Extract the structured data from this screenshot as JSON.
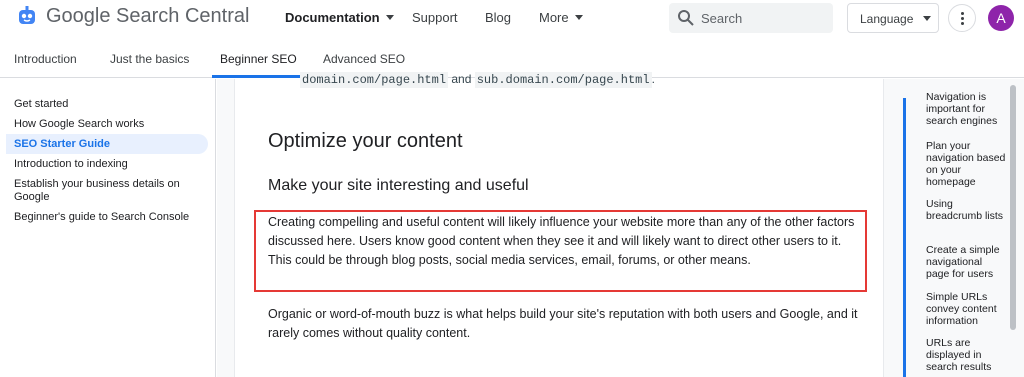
{
  "header": {
    "brand": "Google Search Central",
    "nav": [
      "Documentation",
      "Support",
      "Blog",
      "More"
    ],
    "search_placeholder": "Search",
    "language_label": "Language",
    "avatar_initial": "A"
  },
  "subnav": {
    "tabs": [
      "Introduction",
      "Just the basics",
      "Beginner SEO",
      "Advanced SEO"
    ],
    "active_tab": "Beginner SEO"
  },
  "sidebar": {
    "items": [
      "Get started",
      "How Google Search works",
      "SEO Starter Guide",
      "Introduction to indexing",
      "Establish your business details on Google",
      "Beginner's guide to Search Console"
    ],
    "active_item": "SEO Starter Guide"
  },
  "content": {
    "code_prefix": "domain.com/page.html",
    "code_and": " and ",
    "code_suffix": "sub.domain.com/page.html",
    "code_end": ".",
    "heading": "Optimize your content",
    "subheading": "Make your site interesting and useful",
    "para1": "Creating compelling and useful content will likely influence your website more than any of the other factors discussed here. Users know good content when they see it and will likely want to direct other users to it. This could be through blog posts, social media services, email, forums, or other means.",
    "para2": "Organic or word-of-mouth buzz is what helps build your site's reputation with both users and Google, and it rarely comes without quality content."
  },
  "toc": {
    "items": [
      "Navigation is important for search engines",
      "Plan your navigation based on your homepage",
      "Using breadcrumb lists",
      "Create a simple navigational page for users",
      "Simple URLs convey content information",
      "URLs are displayed in search results"
    ]
  },
  "colors": {
    "accent": "#1a73e8",
    "highlight": "#e53935",
    "avatar": "#8e24aa"
  }
}
